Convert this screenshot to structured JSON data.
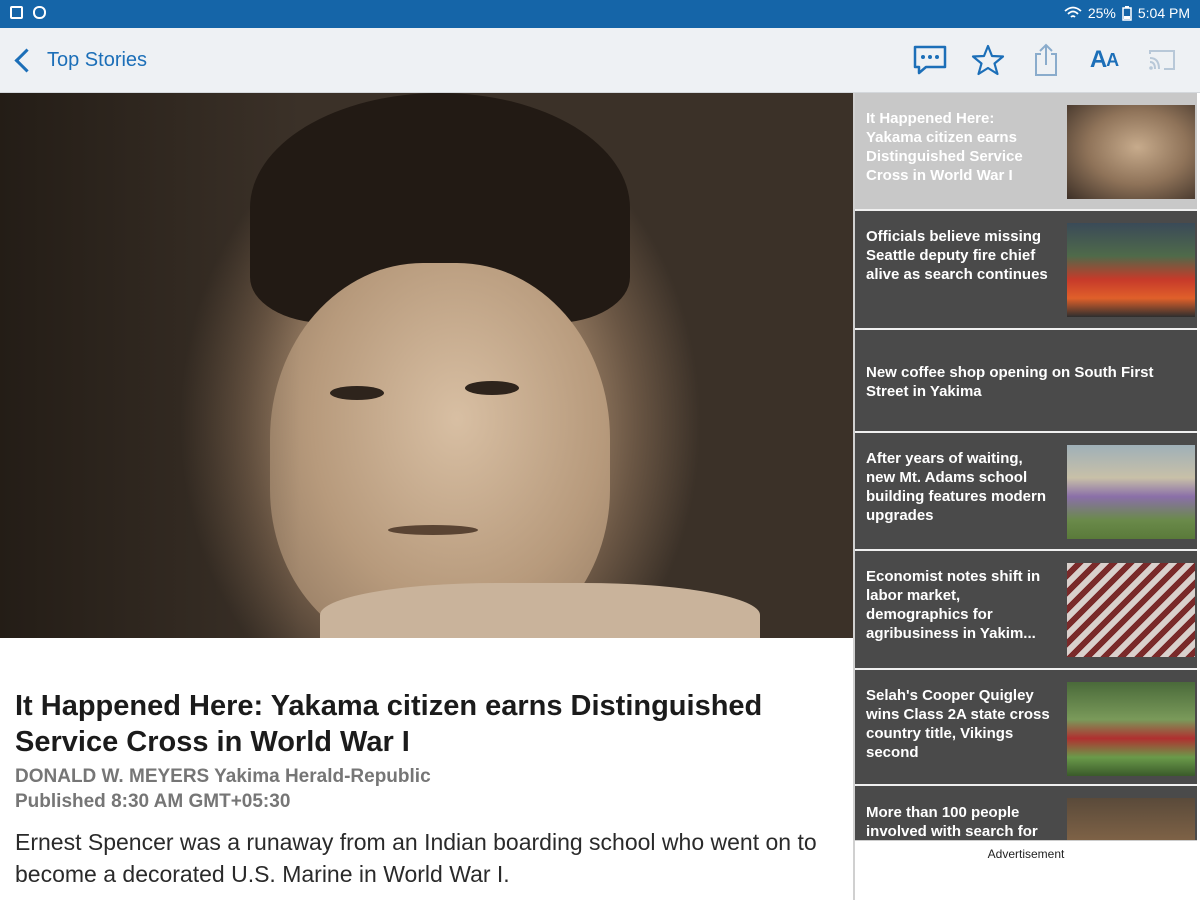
{
  "status_bar": {
    "battery": "25%",
    "time": "5:04 PM"
  },
  "app_bar": {
    "back_label": "Top Stories",
    "text_size_label_large": "A",
    "text_size_label_small": "A"
  },
  "article": {
    "headline": "It Happened Here: Yakama citizen earns Distinguished Service Cross in World War I",
    "byline": "DONALD W. MEYERS Yakima Herald-Republic",
    "published": "Published 8:30 AM GMT+05:30",
    "body": "Ernest Spencer was a runaway from an Indian boarding school who went on to become a decorated U.S. Marine in World War I."
  },
  "sidebar": {
    "stories": [
      {
        "title": "It Happened Here: Yakama citizen earns Distinguished Service Cross in World War I",
        "has_thumb": true,
        "active": true
      },
      {
        "title": "Officials believe missing Seattle deputy fire chief alive as search continues",
        "has_thumb": true
      },
      {
        "title": "New coffee shop opening on South First Street in Yakima",
        "has_thumb": false
      },
      {
        "title": "After years of waiting, new Mt. Adams school building features modern upgrades",
        "has_thumb": true
      },
      {
        "title": "Economist notes shift in labor market, demographics for agribusiness in Yakim...",
        "has_thumb": true
      },
      {
        "title": "Selah's Cooper Quigley wins Class 2A state cross country title, Vikings second",
        "has_thumb": true
      },
      {
        "title": "More than 100 people involved with search for",
        "has_thumb": true
      }
    ]
  },
  "ad": {
    "label": "Advertisement"
  },
  "colors": {
    "status_bar": "#1565a8",
    "accent": "#1c6fb8",
    "sidebar_bg": "#4a4a4a"
  }
}
